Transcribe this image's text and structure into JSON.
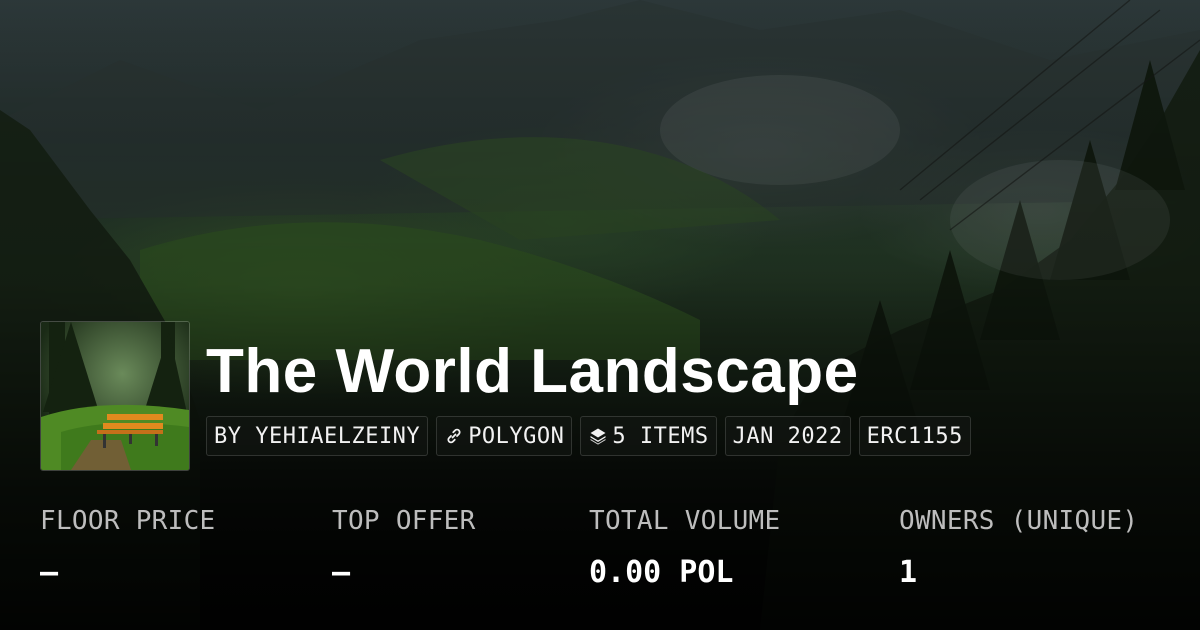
{
  "collection": {
    "title": "The World Landscape",
    "tags": [
      {
        "text": "BY YEHIAELZEINY",
        "icon": ""
      },
      {
        "text": "POLYGON",
        "icon": "link-icon"
      },
      {
        "text": "5 ITEMS",
        "icon": "layers-icon"
      },
      {
        "text": "JAN 2022",
        "icon": ""
      },
      {
        "text": "ERC1155",
        "icon": ""
      }
    ]
  },
  "stats": [
    {
      "label": "FLOOR PRICE",
      "value": "–"
    },
    {
      "label": "TOP OFFER",
      "value": "–"
    },
    {
      "label": "TOTAL VOLUME",
      "value": "0.00 POL"
    },
    {
      "label": "OWNERS (UNIQUE)",
      "value": "1"
    }
  ],
  "colors": {
    "label": "#bdbdbd",
    "value": "#ffffff",
    "bench": "#e08a1e"
  }
}
